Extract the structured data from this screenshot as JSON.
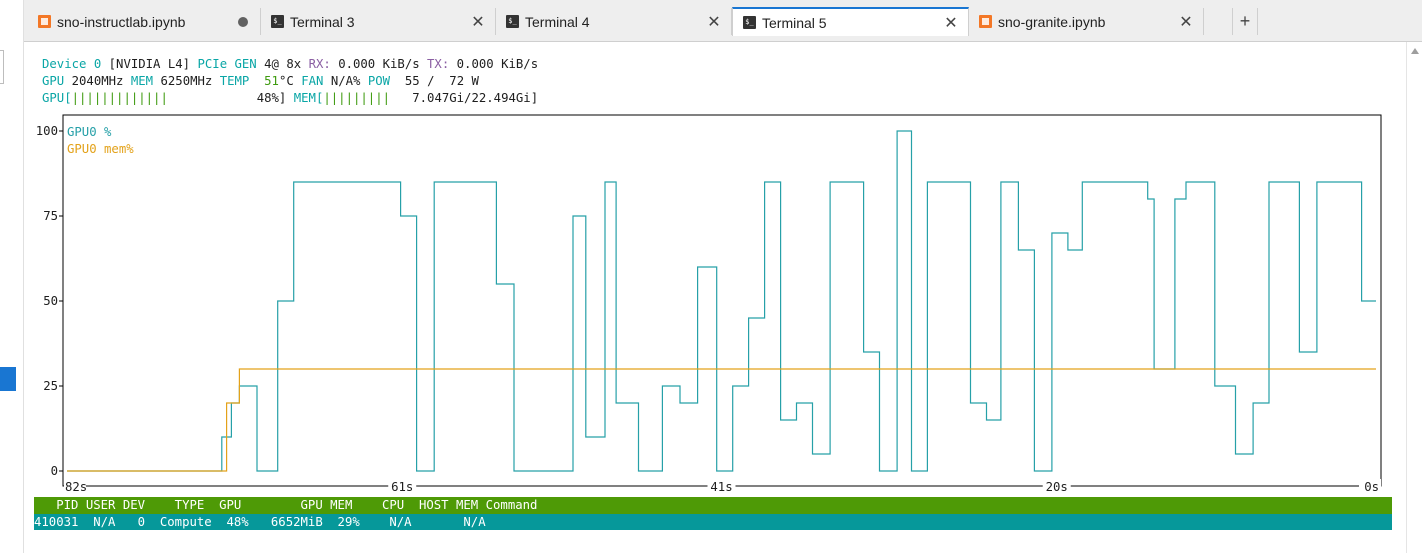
{
  "tabs": [
    {
      "label": "sno-instructlab.ipynb",
      "icon": "notebook-icon",
      "dirty": true,
      "active": false
    },
    {
      "label": "Terminal 3",
      "icon": "terminal-icon",
      "active": false
    },
    {
      "label": "Terminal 4",
      "icon": "terminal-icon",
      "active": false
    },
    {
      "label": "Terminal 5",
      "icon": "terminal-icon",
      "active": true
    },
    {
      "label": "sno-granite.ipynb",
      "icon": "notebook-icon",
      "active": false
    }
  ],
  "new_tab_label": "+",
  "close_glyph": "✕",
  "device": {
    "device_label": "Device 0",
    "name": "[NVIDIA L4]",
    "pcie_label": "PCIe GEN",
    "pcie_gen": "4@",
    "lanes": "8x",
    "rx_label": "RX:",
    "rx": "0.000 KiB/s",
    "tx_label": "TX:",
    "tx": "0.000 KiB/s",
    "gpu_label": "GPU",
    "gpu_clock": "2040MHz",
    "mem_label": "MEM",
    "mem_clock": "6250MHz",
    "temp_label": "TEMP",
    "temp_value": "51",
    "temp_unit": "°C",
    "fan_label": "FAN",
    "fan_value": "N/A%",
    "pow_label": "POW",
    "pow_value": "55 /  72 W",
    "gpu_bar_label": "GPU[",
    "gpu_bar": "|||||||||||||",
    "gpu_pct": "48%]",
    "mem_bar_label": "MEM[",
    "mem_bar": "|||||||||",
    "mem_usage": "7.047Gi/22.494Gi]"
  },
  "chart_data": {
    "type": "line",
    "legend": [
      "GPU0 %",
      "GPU0 mem%"
    ],
    "legend_placement": "top-left",
    "colors": {
      "gpu": "#26a0a8",
      "mem": "#e3a21a",
      "axis": "#000000"
    },
    "ylim": [
      0,
      100
    ],
    "y_ticks": [
      "100",
      "75",
      "50",
      "25",
      "0"
    ],
    "y_tick_values": [
      100,
      75,
      50,
      25,
      0
    ],
    "x_range": [
      -82,
      0
    ],
    "x_ticks": [
      "82s",
      "61s",
      "41s",
      "20s",
      "0s"
    ],
    "x_tick_values": [
      -82,
      -61,
      -41,
      -20,
      0
    ],
    "series": [
      {
        "name": "GPU0 %",
        "step": true,
        "x": [
          -82,
          -72.3,
          -71.7,
          -71.2,
          -70.1,
          -68.8,
          -67.8,
          -66.8,
          -61.1,
          -60.1,
          -59.0,
          -57.9,
          -55.1,
          -54.0,
          -51.9,
          -50.3,
          -49.5,
          -48.3,
          -47.6,
          -46.9,
          -46.2,
          -44.7,
          -43.6,
          -42.5,
          -41.3,
          -40.3,
          -39.3,
          -38.3,
          -37.3,
          -36.3,
          -35.3,
          -34.2,
          -33.3,
          -32.1,
          -31.1,
          -30.0,
          -29.1,
          -28.1,
          -25.4,
          -24.4,
          -23.5,
          -22.4,
          -21.4,
          -20.3,
          -19.3,
          -18.4,
          -17.4,
          -14.3,
          -14.0,
          -13.9,
          -12.6,
          -11.9,
          -10.1,
          -9.8,
          -8.8,
          -7.7,
          -6.7,
          -5.8,
          -4.8,
          -4.3,
          -3.7,
          -2.6,
          -0.9,
          -0.4
        ],
        "y": [
          0,
          10,
          20,
          25,
          0,
          50,
          85,
          85,
          75,
          0,
          85,
          85,
          55,
          0,
          0,
          75,
          10,
          85,
          20,
          20,
          0,
          25,
          20,
          60,
          0,
          25,
          45,
          85,
          15,
          20,
          5,
          85,
          85,
          35,
          0,
          100,
          0,
          85,
          20,
          15,
          85,
          65,
          0,
          70,
          65,
          85,
          85,
          80,
          80,
          30,
          80,
          85,
          25,
          25,
          5,
          20,
          85,
          85,
          35,
          35,
          85,
          85,
          50,
          50
        ]
      },
      {
        "name": "GPU0 mem%",
        "step": true,
        "x": [
          -82,
          -72.0,
          -71.2,
          -0.2
        ],
        "y": [
          0,
          20,
          30,
          30
        ]
      }
    ]
  },
  "processes": {
    "header": "   PID USER DEV    TYPE  GPU        GPU MEM    CPU  HOST MEM Command",
    "rows": [
      {
        "text": "410031  N/A   0  Compute  48%   6652MiB  29%    N/A       N/A"
      }
    ]
  }
}
